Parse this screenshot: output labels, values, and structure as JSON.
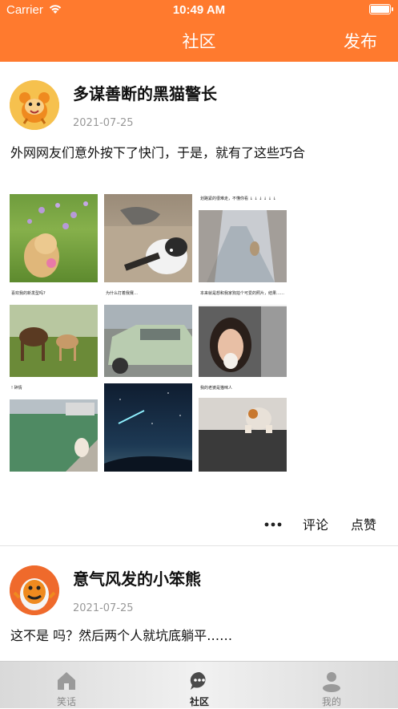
{
  "status_bar": {
    "carrier": "Carrier",
    "time": "10:49 AM"
  },
  "nav": {
    "title": "社区",
    "action": "发布"
  },
  "posts": [
    {
      "author": "多谋善断的黑猫警长",
      "date": "2021-07-25",
      "text": "外网网友们意外按下了快门，于是，就有了这些巧合",
      "photo_captions": [
        "",
        "",
        "划路紧的很难走，不懂你看 ↓ ↓ ↓ ↓ ↓ ↓",
        "喜欢我的新发型吗?",
        "为什么打着我赛…",
        "本来就是想和我家狗拍个可爱的照片，结果……",
        "! 碎情",
        "",
        "我的老婆是猫咪人"
      ],
      "actions": {
        "comment": "评论",
        "like": "点赞"
      }
    },
    {
      "author": "意气风发的小笨熊",
      "date": "2021-07-25",
      "text": "这不是 吗？然后两个人就坑底躺平……"
    }
  ],
  "tabbar": {
    "items": [
      {
        "label": "笑话"
      },
      {
        "label": "社区"
      },
      {
        "label": "我的"
      }
    ],
    "active_index": 1
  },
  "colors": {
    "accent": "#ff7a2e",
    "divider": "#e2e2e2",
    "date": "#999999"
  }
}
